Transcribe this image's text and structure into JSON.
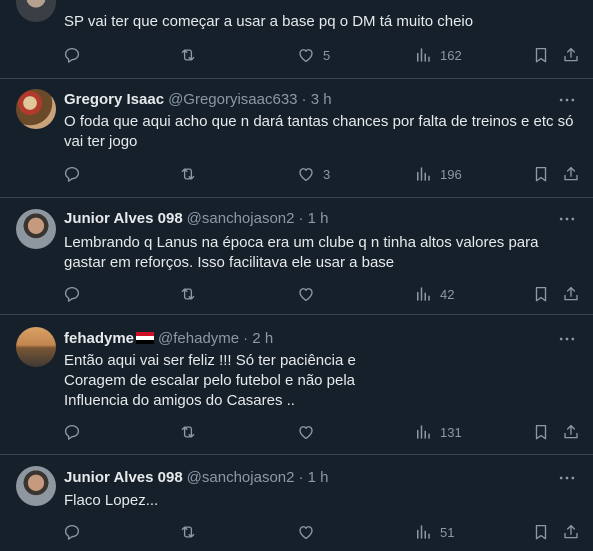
{
  "tweets": [
    {
      "name": "",
      "handle": "",
      "time": "",
      "text": "SP vai ter que começar a usar a base pq o DM tá muito cheio",
      "replies": "",
      "retweets": "",
      "likes": "5",
      "views": "162"
    },
    {
      "name": "Gregory Isaac",
      "handle": "@Gregoryisaac633",
      "time": "· 3 h",
      "text": "O foda que aqui acho que n dará tantas chances por falta de treinos e etc só vai ter jogo",
      "replies": "",
      "retweets": "",
      "likes": "3",
      "views": "196"
    },
    {
      "name": "Junior Alves 098",
      "handle": "@sanchojason2",
      "time": "· 1 h",
      "text": "Lembrando q Lanus na época era um clube q n tinha altos valores para gastar em reforços. Isso facilitava ele usar a base",
      "replies": "",
      "retweets": "",
      "likes": "",
      "views": "42"
    },
    {
      "name": "fehadyme",
      "handle": "@fehadyme",
      "time": "· 2 h",
      "text": "Então aqui vai ser feliz !!! Só ter paciência e\nCoragem de escalar pelo futebol e não pela\nInfluencia do amigos do Casares ..",
      "replies": "",
      "retweets": "",
      "likes": "",
      "views": "131"
    },
    {
      "name": "Junior Alves 098",
      "handle": "@sanchojason2",
      "time": "· 1 h",
      "text": "Flaco Lopez...",
      "replies": "",
      "retweets": "",
      "likes": "",
      "views": "51"
    }
  ],
  "icons": {
    "reply": "reply-icon",
    "retweet": "retweet-icon",
    "like": "heart-icon",
    "views": "views-icon",
    "bookmark": "bookmark-icon",
    "share": "share-icon",
    "more": "more-icon"
  },
  "colors": {
    "background": "#15202b",
    "muted": "#8b98a5",
    "text": "#e7e9ea",
    "divider": "#38444d"
  }
}
